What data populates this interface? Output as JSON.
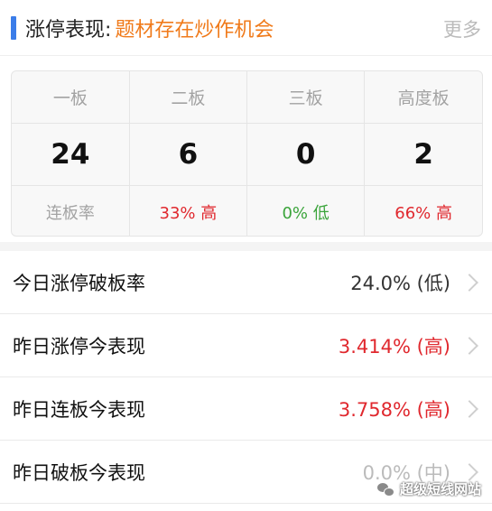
{
  "header": {
    "title": "涨停表现:",
    "subtitle": "题材存在炒作机会",
    "more_label": "更多"
  },
  "grid": {
    "columns": [
      "一板",
      "二板",
      "三板",
      "高度板"
    ],
    "values": [
      "24",
      "6",
      "0",
      "2"
    ],
    "rate_label": "连板率",
    "rates": [
      {
        "text": "33% 高",
        "tone": "red"
      },
      {
        "text": "0% 低",
        "tone": "green"
      },
      {
        "text": "66% 高",
        "tone": "red"
      }
    ]
  },
  "list": [
    {
      "label": "今日涨停破板率",
      "value": "24.0% (低)",
      "tone": "dark"
    },
    {
      "label": "昨日涨停今表现",
      "value": "3.414% (高)",
      "tone": "red"
    },
    {
      "label": "昨日连板今表现",
      "value": "3.758% (高)",
      "tone": "red"
    },
    {
      "label": "昨日破板今表现",
      "value": "0.0% (中)",
      "tone": "gray"
    }
  ],
  "watermark": {
    "text": "超级短线网站",
    "icon": "wechat-icon"
  },
  "colors": {
    "accent_blue": "#3b7de9",
    "orange": "#f07a1a",
    "red": "#e0282e",
    "green": "#3aa43a"
  }
}
